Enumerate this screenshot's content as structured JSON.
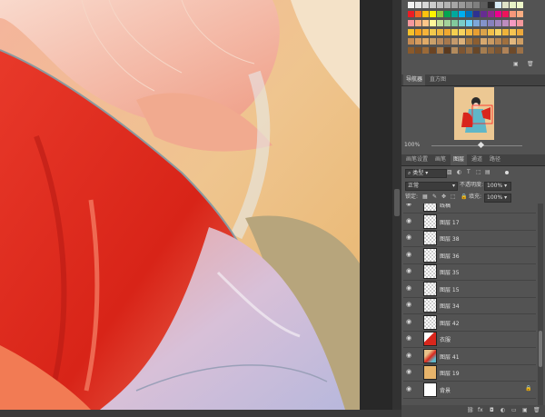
{
  "swatches": {
    "rows": [
      [
        "#f2f2f2",
        "#e6e6e6",
        "#d9d9d9",
        "#cccccc",
        "#bfbfbf",
        "#b3b3b3",
        "#a6a6a6",
        "#999999",
        "#8c8c8c",
        "#7f7f7f",
        "#5c5c5c",
        "#2b2b2b",
        "#d6eaf5",
        "#dfe3c7",
        "#e7f2c6",
        "#eef7c9"
      ],
      [
        "#ec1c24",
        "#f26522",
        "#ffc20e",
        "#fff200",
        "#8dc63f",
        "#00a651",
        "#00a99d",
        "#00aeef",
        "#0072bc",
        "#2e3192",
        "#662d91",
        "#92278f",
        "#ec008c",
        "#ed145b",
        "#f7977a",
        "#fbad82"
      ],
      [
        "#f6989d",
        "#f9ad81",
        "#fdc68a",
        "#fff79a",
        "#c4df9b",
        "#a3d39c",
        "#82ca9d",
        "#7accc8",
        "#6dcff6",
        "#7da7d9",
        "#8393ca",
        "#8781bd",
        "#a187be",
        "#bd8cbf",
        "#f49ac1",
        "#f5989d"
      ],
      [
        "#f5c12b",
        "#f7a21c",
        "#f6b33a",
        "#f2c94c",
        "#efb63e",
        "#f0a830",
        "#f4cf4f",
        "#f8d35e",
        "#f5b941",
        "#e89f32",
        "#dba34a",
        "#f2c049",
        "#f7d463",
        "#efb33a",
        "#f6c452",
        "#eda93c"
      ],
      [
        "#c68c53",
        "#d49a5d",
        "#e0aa67",
        "#caa06a",
        "#b98a5c",
        "#a7784c",
        "#c49a6c",
        "#dbb07a",
        "#a6773f",
        "#8c5e31",
        "#d7a86e",
        "#c99a62",
        "#b68552",
        "#a0703f",
        "#e2b77e",
        "#cf9e63"
      ],
      [
        "#8a5a2b",
        "#7a4e26",
        "#9b6a38",
        "#6b4423",
        "#a87a49",
        "#5c3a1e",
        "#b38b5d",
        "#7d5532",
        "#946b42",
        "#684728",
        "#a57d50",
        "#8f663d",
        "#7a5533",
        "#b08358",
        "#6e4a2a",
        "#9c7147"
      ]
    ]
  },
  "navigator": {
    "tabs": [
      "导航器",
      "直方图"
    ],
    "zoom_label": "100%"
  },
  "layers_panel": {
    "tabs": [
      "画笔设置",
      "画笔",
      "图层",
      "通道",
      "路径"
    ],
    "active_tab_index": 2,
    "filter_kind": "类型",
    "blend_mode": "正常",
    "opacity_label": "不透明度:",
    "opacity_value": "100%",
    "lock_label": "锁定:",
    "fill_label": "填充:",
    "fill_value": "100%",
    "layers": [
      {
        "name": "线稿",
        "thumb": "checker"
      },
      {
        "name": "图层 17",
        "thumb": "checker"
      },
      {
        "name": "图层 38",
        "thumb": "checker"
      },
      {
        "name": "图层 36",
        "thumb": "checker"
      },
      {
        "name": "图层 35",
        "thumb": "checker"
      },
      {
        "name": "图层 15",
        "thumb": "checker"
      },
      {
        "name": "图层 34",
        "thumb": "checker"
      },
      {
        "name": "图层 42",
        "thumb": "checker"
      },
      {
        "name": "衣服",
        "thumb": "red"
      },
      {
        "name": "图层 41",
        "thumb": "figure"
      },
      {
        "name": "图层 19",
        "thumb": "yellow"
      },
      {
        "name": "背景",
        "thumb": "white"
      }
    ]
  }
}
